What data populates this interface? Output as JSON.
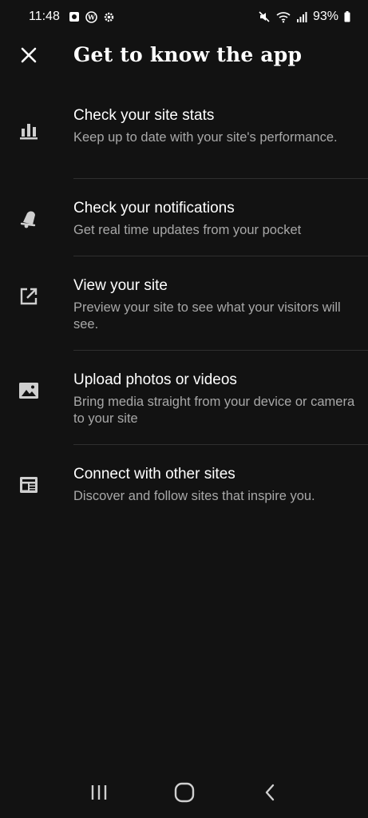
{
  "status_bar": {
    "time": "11:48",
    "battery": "93%",
    "left_icons": [
      "notification-icon",
      "wordpress-icon",
      "settings-gear-icon"
    ],
    "right_icons": [
      "mute-icon",
      "wifi-icon",
      "signal-icon",
      "battery-icon"
    ]
  },
  "header": {
    "title": "Get to know the app",
    "close_icon": "close-icon"
  },
  "features": [
    {
      "icon": "bar-chart-icon",
      "title": "Check your site stats",
      "description": "Keep up to date with your site's performance."
    },
    {
      "icon": "bell-icon",
      "title": "Check your notifications",
      "description": "Get real time updates from your pocket"
    },
    {
      "icon": "external-link-icon",
      "title": "View your site",
      "description": "Preview your site to see what your visitors will see."
    },
    {
      "icon": "image-icon",
      "title": "Upload photos or videos",
      "description": "Bring media straight from your device or camera to your site"
    },
    {
      "icon": "reader-icon",
      "title": "Connect with other sites",
      "description": "Discover and follow sites that inspire you."
    }
  ],
  "nav_bar": {
    "buttons": [
      "recents-icon",
      "home-icon",
      "back-icon"
    ]
  },
  "colors": {
    "background": "#121212",
    "text_primary": "#ffffff",
    "text_secondary": "#a8a8a8",
    "icon": "#cfcfcf",
    "divider": "#2f2f2f"
  }
}
